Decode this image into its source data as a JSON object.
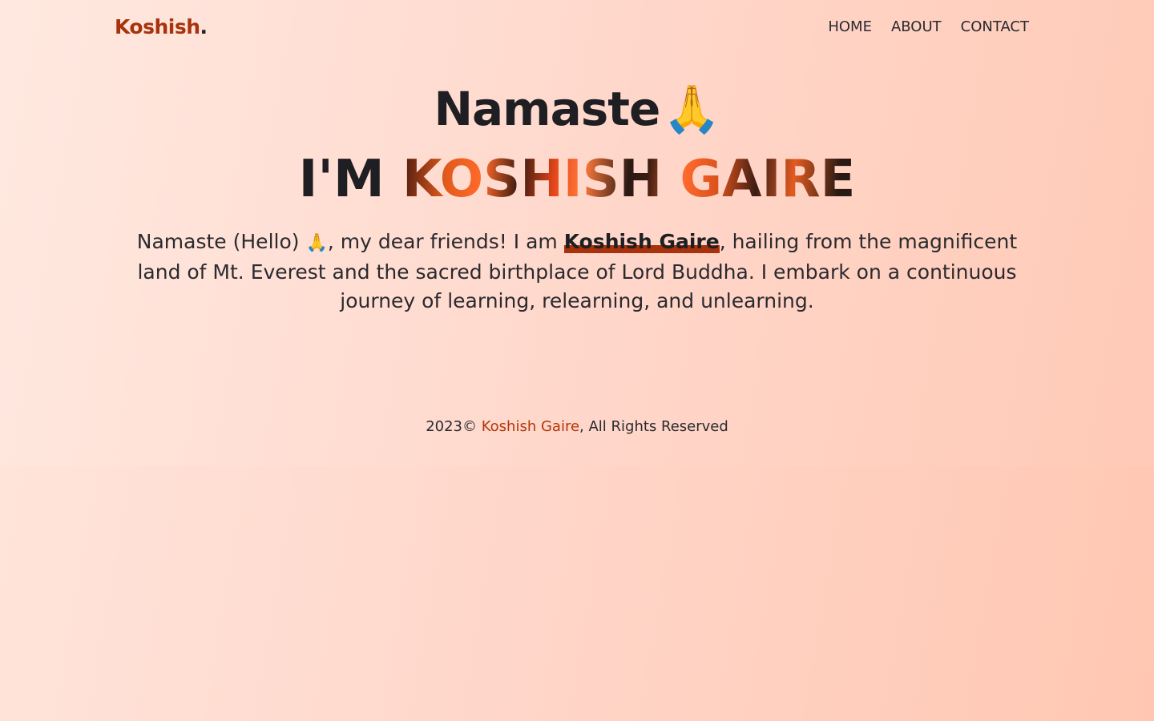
{
  "header": {
    "brand": "Koshish",
    "brand_dot": ".",
    "nav": [
      {
        "label": "HOME"
      },
      {
        "label": "ABOUT"
      },
      {
        "label": "CONTACT"
      }
    ]
  },
  "hero": {
    "greeting": "Namaste",
    "greeting_emoji": "🙏",
    "im_prefix": "I'M ",
    "name_upper": "KOSHISH GAIRE",
    "intro_before": "Namaste (Hello) ",
    "intro_emoji": "🙏",
    "intro_mid": ", my dear friends! I am ",
    "intro_name": "Koshish Gaire",
    "intro_after": ", hailing from the magnificent land of Mt. Everest and the sacred birthplace of Lord Buddha. I embark on a continuous journey of learning, relearning, and unlearning."
  },
  "footer": {
    "year": "2023©",
    "owner": "Koshish Gaire",
    "rights": ", All Rights Reserved"
  },
  "colors": {
    "accent": "#a8320b",
    "text": "#1f1f23",
    "background_start": "#ffe6dd",
    "background_end": "#ffc7b2"
  }
}
